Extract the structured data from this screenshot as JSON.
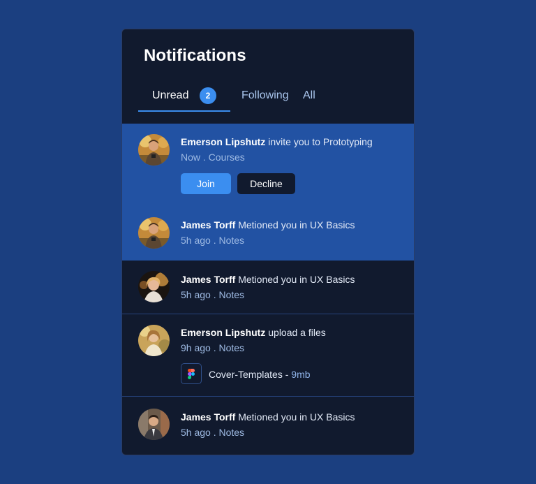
{
  "panel": {
    "title": "Notifications"
  },
  "tabs": [
    {
      "label": "Unread",
      "badge": "2",
      "active": true
    },
    {
      "label": "Following",
      "active": false
    },
    {
      "label": "All",
      "active": false
    }
  ],
  "notifications": [
    {
      "name": "Emerson Lipshutz",
      "message": " invite you to Prototyping",
      "meta": "Now . Courses",
      "unread": true,
      "actions": {
        "join": "Join",
        "decline": "Decline"
      }
    },
    {
      "name": "James Torff",
      "message": " Metioned you in UX Basics",
      "meta": "5h ago . Notes",
      "unread": true
    },
    {
      "name": "James Torff",
      "message": " Metioned you in UX Basics",
      "meta": "5h ago . Notes",
      "unread": false
    },
    {
      "name": "Emerson Lipshutz",
      "message": " upload a files",
      "meta": "9h ago . Notes",
      "unread": false,
      "file": {
        "name": "Cover-Templates",
        "separator": " - ",
        "size": "9mb",
        "icon": "figma-icon"
      }
    },
    {
      "name": "James Torff",
      "message": " Metioned you in UX Basics",
      "meta": "5h ago . Notes",
      "unread": false
    }
  ],
  "colors": {
    "page_bg": "#1b3f80",
    "panel_bg": "#111a2e",
    "unread_bg": "#2252a3",
    "accent": "#3b8ef0"
  }
}
